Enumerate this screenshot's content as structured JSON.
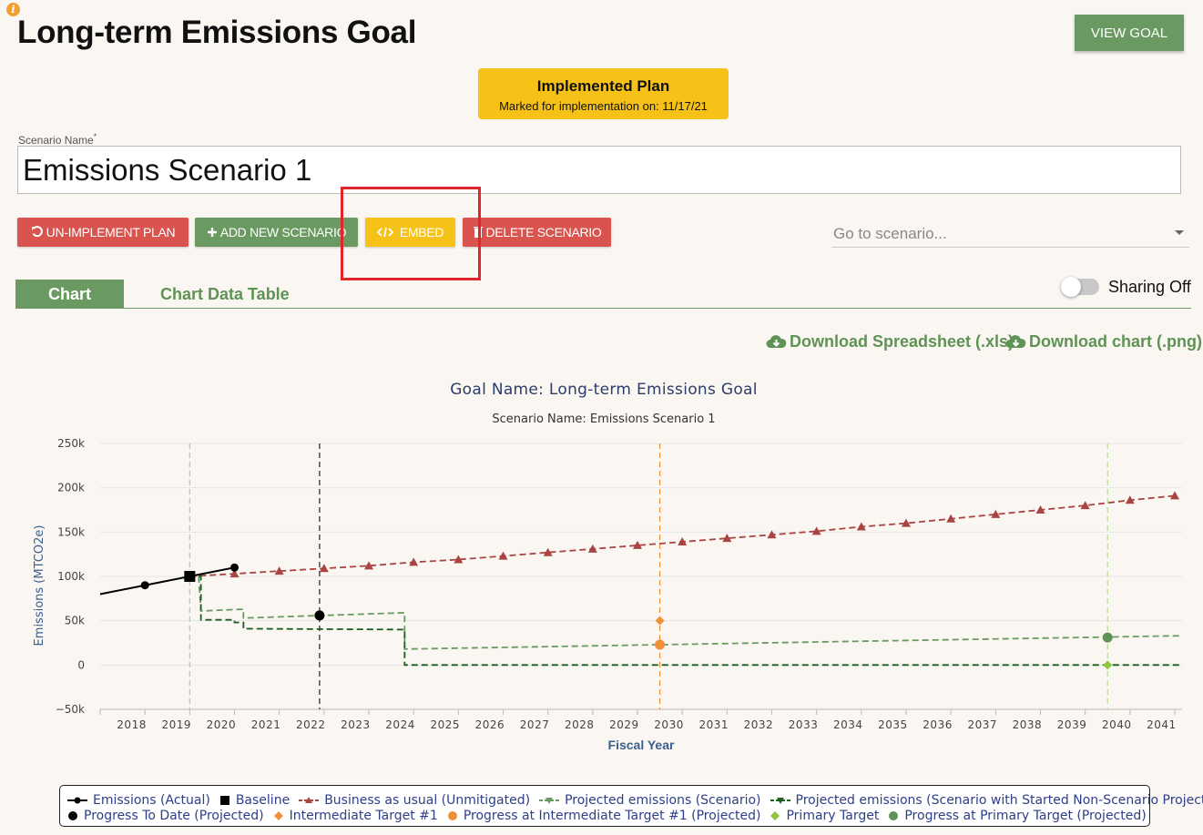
{
  "header": {
    "info_icon": "i",
    "title": "Long-term Emissions Goal",
    "view_goal_label": "VIEW GOAL"
  },
  "banner": {
    "title": "Implemented Plan",
    "subtitle": "Marked for implementation on: 11/17/21"
  },
  "scenario": {
    "label": "Scenario Name",
    "required_mark": "*",
    "value": "Emissions Scenario 1"
  },
  "actions": {
    "unimplement": "UN-IMPLEMENT PLAN",
    "add_new": "ADD NEW SCENARIO",
    "embed": "EMBED",
    "delete": "DELETE SCENARIO",
    "goto_placeholder": "Go to scenario..."
  },
  "tabs": {
    "chart": "Chart",
    "table": "Chart Data Table"
  },
  "sharing": {
    "label": "Sharing Off",
    "on": false
  },
  "downloads": {
    "spreadsheet": "Download Spreadsheet (.xls)",
    "chart": "Download chart (.png)"
  },
  "colors": {
    "green": "#6a9a62",
    "red": "#d9534f",
    "yellow": "#f6c218",
    "highlight": "#e0262b"
  },
  "chart_data": {
    "type": "line",
    "title": "Goal Name: Long-term Emissions Goal",
    "subtitle": "Scenario Name: Emissions Scenario 1",
    "xlabel": "Fiscal Year",
    "ylabel": "Emissions (MTCO2e)",
    "x_ticks": [
      "2018",
      "2019",
      "2020",
      "2021",
      "2022",
      "2023",
      "2024",
      "2025",
      "2026",
      "2027",
      "2028",
      "2029",
      "2030",
      "2031",
      "2032",
      "2033",
      "2034",
      "2035",
      "2036",
      "2037",
      "2038",
      "2039",
      "2040",
      "2041"
    ],
    "y_ticks": [
      "250k",
      "200k",
      "150k",
      "100k",
      "50k",
      "0",
      "−50k"
    ],
    "ylim": [
      -50000,
      250000
    ],
    "legend_position": "bottom",
    "series": [
      {
        "name": "Emissions (Actual)",
        "color": "#000000",
        "x": [
          2017.5,
          2018.5,
          2019.5,
          2020.5
        ],
        "y": [
          80000,
          90000,
          100000,
          110000
        ]
      },
      {
        "name": "Baseline",
        "color": "#000000",
        "x": [
          2019.5
        ],
        "y": [
          100000
        ]
      },
      {
        "name": "Business as usual (Unmitigated)",
        "color": "#a94442",
        "x": [
          2019.5,
          2020.5,
          2021.5,
          2022.5,
          2023.5,
          2024.5,
          2025.5,
          2026.5,
          2027.5,
          2028.5,
          2029.5,
          2030.5,
          2031.5,
          2032.5,
          2033.5,
          2034.5,
          2035.5,
          2036.5,
          2037.5,
          2038.5,
          2039.5,
          2040.5,
          2041.5
        ],
        "y": [
          100000,
          103000,
          106000,
          109000,
          112000,
          116000,
          119000,
          123000,
          127000,
          131000,
          135000,
          139000,
          143000,
          147000,
          151000,
          156000,
          160000,
          165000,
          170000,
          175000,
          180000,
          186000,
          191000
        ]
      },
      {
        "name": "Projected emissions (Scenario)",
        "color": "#6a9a62",
        "x": [
          2019.8,
          2020.7,
          2024.3,
          2041.6
        ],
        "y": [
          61000,
          63000,
          59000,
          33000
        ]
      },
      {
        "name": "Projected emissions (Scenario with Started Non-Scenario Projects)",
        "color": "#1b5e20",
        "x": [
          2019.8,
          2020.7,
          2024.3,
          2041.6
        ],
        "y": [
          51000,
          42000,
          40000,
          0
        ]
      },
      {
        "name": "Progress To Date (Projected)",
        "color": "#000000",
        "x": [
          2022.4
        ],
        "y": [
          56000
        ]
      },
      {
        "name": "Intermediate Target #1",
        "color": "#f0913a",
        "x": [
          2030
        ],
        "y": [
          50000
        ]
      },
      {
        "name": "Progress at Intermediate Target #1 (Projected)",
        "color": "#f0913a",
        "x": [
          2030
        ],
        "y": [
          23000
        ]
      },
      {
        "name": "Primary Target",
        "color": "#8dc63f",
        "x": [
          2040
        ],
        "y": [
          0
        ]
      },
      {
        "name": "Progress at Primary Target (Projected)",
        "color": "#5f9255",
        "x": [
          2040
        ],
        "y": [
          31000
        ]
      }
    ],
    "vertical_markers": [
      {
        "x": 2019.5,
        "color": "#bbbbbb"
      },
      {
        "x": 2022.4,
        "color": "#222222"
      },
      {
        "x": 2030,
        "color": "#f0913a"
      },
      {
        "x": 2040,
        "color": "#b5d98d"
      }
    ]
  }
}
